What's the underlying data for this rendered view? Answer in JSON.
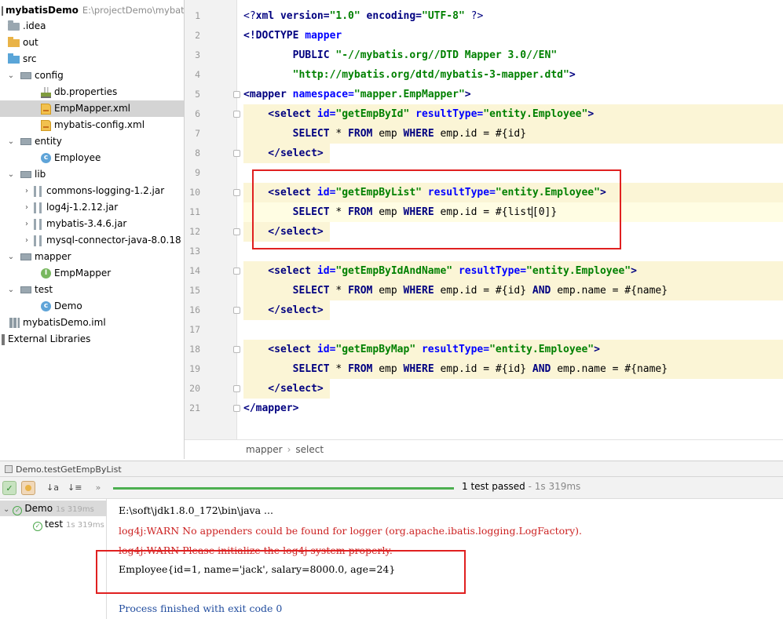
{
  "project_tree": {
    "root": {
      "name": "mybatisDemo",
      "path": "E:\\projectDemo\\mybat"
    },
    "items": [
      {
        "label": "mybatisDemo",
        "icon": "project-folder-icon"
      },
      {
        "label": ".idea",
        "icon": "folder-icon"
      },
      {
        "label": "out",
        "icon": "folder-orange-icon"
      },
      {
        "label": "src",
        "icon": "source-folder-icon"
      },
      {
        "label": "config",
        "icon": "package-icon"
      },
      {
        "label": "db.properties",
        "icon": "properties-file-icon"
      },
      {
        "label": "EmpMapper.xml",
        "icon": "xml-file-icon"
      },
      {
        "label": "mybatis-config.xml",
        "icon": "xml-file-icon"
      },
      {
        "label": "entity",
        "icon": "package-icon"
      },
      {
        "label": "Employee",
        "icon": "class-icon"
      },
      {
        "label": "lib",
        "icon": "package-icon"
      },
      {
        "label": "commons-logging-1.2.jar",
        "icon": "jar-icon"
      },
      {
        "label": "log4j-1.2.12.jar",
        "icon": "jar-icon"
      },
      {
        "label": "mybatis-3.4.6.jar",
        "icon": "jar-icon"
      },
      {
        "label": "mysql-connector-java-8.0.18",
        "icon": "jar-icon"
      },
      {
        "label": "mapper",
        "icon": "package-icon"
      },
      {
        "label": "EmpMapper",
        "icon": "interface-icon"
      },
      {
        "label": "test",
        "icon": "package-icon"
      },
      {
        "label": "Demo",
        "icon": "test-class-icon"
      },
      {
        "label": "mybatisDemo.iml",
        "icon": "module-file-icon"
      },
      {
        "label": "External Libraries",
        "icon": "libraries-icon"
      }
    ]
  },
  "editor": {
    "line_numbers": [
      "1",
      "2",
      "3",
      "4",
      "5",
      "6",
      "7",
      "8",
      "9",
      "10",
      "11",
      "12",
      "13",
      "14",
      "15",
      "16",
      "17",
      "18",
      "19",
      "20",
      "21"
    ],
    "lines": {
      "l1": {
        "a": "<?",
        "b": "xml version=",
        "c": "\"1.0\"",
        "d": " encoding=",
        "e": "\"UTF-8\"",
        "f": " ?>"
      },
      "l2": {
        "a": "<!DOCTYPE ",
        "b": "mapper"
      },
      "l3": {
        "a": "        PUBLIC ",
        "b": "\"-//mybatis.org//DTD Mapper 3.0//EN\""
      },
      "l4": {
        "a": "        \"http://mybatis.org/dtd/mybatis-3-mapper.dtd\"",
        "b": ">"
      },
      "l5": {
        "a": "<mapper ",
        "b": "namespace=",
        "c": "\"mapper.EmpMapper\"",
        "d": ">"
      },
      "l6": {
        "a": "    <select ",
        "b": "id=",
        "c": "\"getEmpById\"",
        "d": " resultType=",
        "e": "\"entity.Employee\"",
        "f": ">"
      },
      "l7": {
        "a": "        SELECT ",
        "b": "* ",
        "c": "FROM ",
        "d": "emp ",
        "e": "WHERE ",
        "f": "emp.id = #{id}"
      },
      "l8": {
        "a": "    </select>"
      },
      "l10": {
        "a": "    <select ",
        "b": "id=",
        "c": "\"getEmpByList\"",
        "d": " resultType=",
        "e": "\"entity.Employee\"",
        "f": ">"
      },
      "l11": {
        "a": "        SELECT ",
        "b": "* ",
        "c": "FROM ",
        "d": "emp ",
        "e": "WHERE ",
        "f": "emp.id = #{list",
        "g": "[0]}"
      },
      "l12": {
        "a": "    </select>"
      },
      "l14": {
        "a": "    <select ",
        "b": "id=",
        "c": "\"getEmpByIdAndName\"",
        "d": " resultType=",
        "e": "\"entity.Employee\"",
        "f": ">"
      },
      "l15": {
        "a": "        SELECT ",
        "b": "* ",
        "c": "FROM ",
        "d": "emp ",
        "e": "WHERE ",
        "f": "emp.id = #{id} ",
        "g": "AND ",
        "h": "emp.name = #{name}"
      },
      "l16": {
        "a": "    </select>"
      },
      "l18": {
        "a": "    <select ",
        "b": "id=",
        "c": "\"getEmpByMap\"",
        "d": " resultType=",
        "e": "\"entity.Employee\"",
        "f": ">"
      },
      "l19": {
        "a": "        SELECT ",
        "b": "* ",
        "c": "FROM ",
        "d": "emp ",
        "e": "WHERE ",
        "f": "emp.id = #{id} ",
        "g": "AND ",
        "h": "emp.name = #{name}"
      },
      "l20": {
        "a": "    </select>"
      },
      "l21": {
        "a": "</mapper>"
      }
    },
    "breadcrumb": {
      "first": "mapper",
      "sep": "›",
      "second": "select"
    }
  },
  "run_panel": {
    "tab_title": "Demo.testGetEmpByList",
    "status": {
      "passed": "1 test passed",
      "sep": " - ",
      "time": "1s 319ms"
    },
    "toolbar": {
      "sort_alpha": "↓a",
      "sort_dur": "↓≡",
      "more": "»"
    },
    "tests": [
      {
        "name": "Demo",
        "time": "1s 319ms"
      },
      {
        "name": "test",
        "time": "1s 319ms"
      }
    ],
    "console": {
      "cmd": "E:\\soft\\jdk1.8.0_172\\bin\\java ...",
      "warn1": "log4j:WARN No appenders could be found for logger (org.apache.ibatis.logging.LogFactory).",
      "warn2": "log4j:WARN Please initialize the log4j system properly.",
      "output": "Employee{id=1, name='jack', salary=8000.0, age=24}",
      "exit": "Process finished with exit code 0"
    }
  },
  "colors": {
    "tag": "#000080",
    "attr": "#0000ff",
    "value": "#008000",
    "highlight": "#fbf5d6",
    "annotation_box": "#e02020",
    "progress": "#4caf50"
  }
}
